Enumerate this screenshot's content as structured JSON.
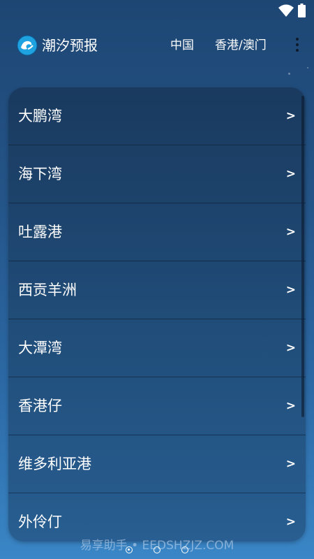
{
  "status_bar": {
    "icons": [
      "wifi-icon",
      "battery-icon"
    ]
  },
  "app_bar": {
    "logo_icon": "wave-logo-icon",
    "title": "潮汐预报",
    "tabs": [
      {
        "label": "中国"
      },
      {
        "label": "香港/澳门"
      }
    ],
    "more_icon": "more-vertical-icon"
  },
  "locations": [
    {
      "name": "大鹏湾",
      "chevron": ">"
    },
    {
      "name": "海下湾",
      "chevron": ">"
    },
    {
      "name": "吐露港",
      "chevron": ">"
    },
    {
      "name": "西贡羊洲",
      "chevron": ">"
    },
    {
      "name": "大潭湾",
      "chevron": ">"
    },
    {
      "name": "香港仔",
      "chevron": ">"
    },
    {
      "name": "维多利亚港",
      "chevron": ">"
    },
    {
      "name": "外伶仃",
      "chevron": ">"
    }
  ],
  "watermark": "易享助手 • EEDSHZJZ.COM",
  "page_indicator": {
    "count": 3,
    "active_index": 0
  }
}
